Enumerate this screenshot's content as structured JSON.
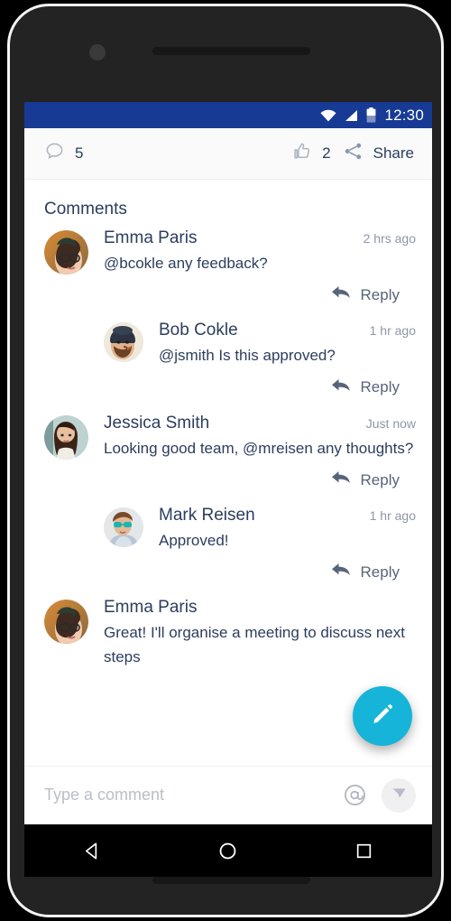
{
  "status_bar": {
    "time": "12:30",
    "icons": [
      "wifi-icon",
      "signal-icon",
      "battery-icon"
    ],
    "background_color": "#173a94"
  },
  "action_bar": {
    "comment_icon": "comment-bubble-icon",
    "comment_count": "5",
    "like_icon": "thumbs-up-icon",
    "like_count": "2",
    "share_icon": "share-icon",
    "share_label": "Share",
    "background_color": "#fafafa"
  },
  "comments_section": {
    "title": "Comments",
    "reply_label": "Reply",
    "reply_icon": "reply-arrow-icon",
    "comments": [
      {
        "name": "Emma Paris",
        "time": "2 hrs ago",
        "text": "@bcokle  any feedback?",
        "level": 1,
        "avatar": "emma-paris-avatar"
      },
      {
        "name": "Bob Cokle",
        "time": "1 hr ago",
        "text": "@jsmith  Is this approved?",
        "level": 2,
        "avatar": "bob-cokle-avatar"
      },
      {
        "name": "Jessica Smith",
        "time": "Just now",
        "text": "Looking good team, @mreisen any thoughts?",
        "level": 1,
        "avatar": "jessica-smith-avatar"
      },
      {
        "name": "Mark Reisen",
        "time": "1 hr ago",
        "text": "Approved!",
        "level": 2,
        "avatar": "mark-reisen-avatar"
      },
      {
        "name": "Emma Paris",
        "time": "",
        "text": "Great! I'll organise a meeting to discuss next steps",
        "level": 1,
        "avatar": "emma-paris-avatar"
      }
    ]
  },
  "fab": {
    "icon": "pencil-edit-icon",
    "color": "#16b4d8"
  },
  "composer": {
    "placeholder": "Type a comment",
    "value": "",
    "mention_icon": "at-mention-icon",
    "send_icon": "send-paper-plane-icon"
  },
  "android_nav": {
    "back": "back-triangle-icon",
    "home": "home-circle-icon",
    "recents": "recents-square-icon"
  }
}
